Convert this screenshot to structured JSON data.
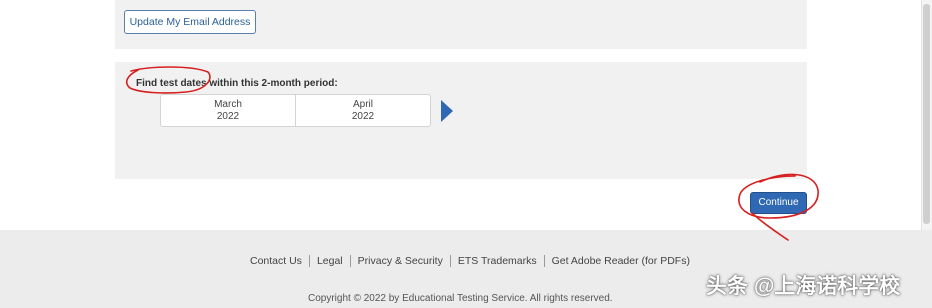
{
  "email_section": {
    "update_button_label": "Update My Email Address"
  },
  "date_section": {
    "heading": "Find test dates within this 2-month period:",
    "months": [
      {
        "month": "March",
        "year": "2022"
      },
      {
        "month": "April",
        "year": "2022"
      }
    ]
  },
  "continue_label": "Continue",
  "footer": {
    "links": [
      "Contact Us",
      "Legal",
      "Privacy & Security",
      "ETS Trademarks",
      "Get Adobe Reader (for PDFs)"
    ],
    "copyright": "Copyright © 2022 by Educational Testing Service. All rights reserved."
  },
  "watermark": "头条 @上海诺科学校",
  "colors": {
    "accent": "#2f68b3",
    "annotation": "#d62020",
    "panel": "#f1f1f2",
    "footer_bg": "#ececec"
  }
}
